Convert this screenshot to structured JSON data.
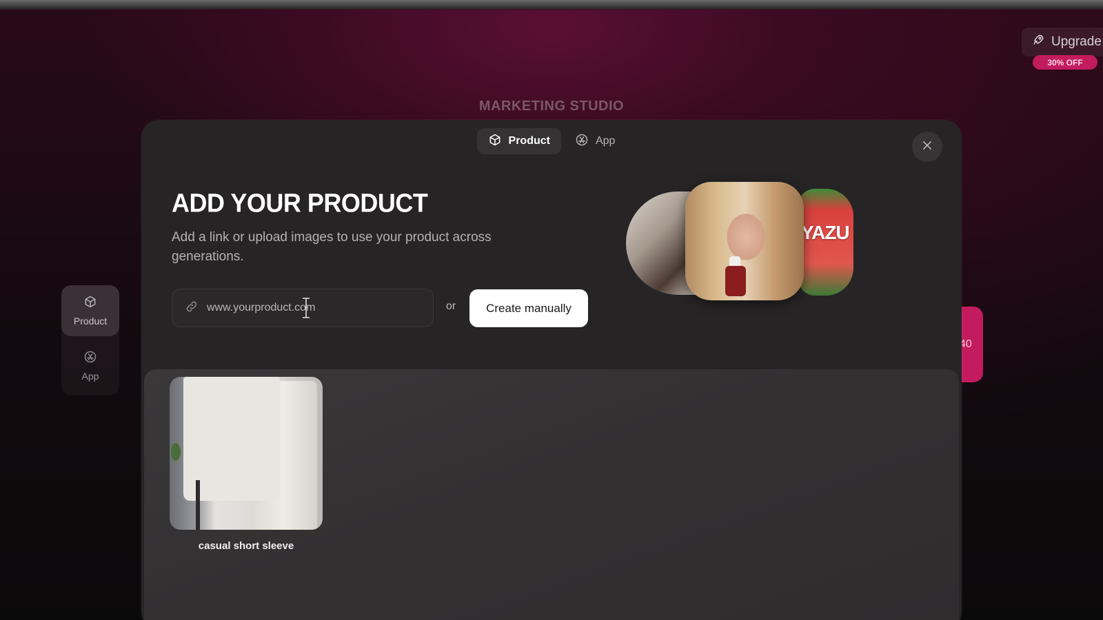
{
  "background": {
    "title": "MARKETING STUDIO",
    "upgrade_label": "Upgrade",
    "discount_badge": "30% OFF",
    "side_nav": [
      {
        "label": "Product",
        "icon": "cube-icon",
        "active": true
      },
      {
        "label": "App",
        "icon": "app-store-icon",
        "active": false
      }
    ],
    "pink_pill_text": "40"
  },
  "modal": {
    "tabs": [
      {
        "label": "Product",
        "icon": "cube-icon",
        "active": true
      },
      {
        "label": "App",
        "icon": "app-store-icon",
        "active": false
      }
    ],
    "heading": "ADD YOUR PRODUCT",
    "subtext": "Add a link or upload images to use your product across generations.",
    "url_input": {
      "value": "",
      "placeholder": "www.yourproduct.com"
    },
    "or_label": "or",
    "create_button_label": "Create manually",
    "collage_brand_text": "YAZU",
    "products": [
      {
        "name": "casual short sleeve"
      }
    ]
  },
  "colors": {
    "accent": "#c21c5e",
    "modal_bg": "#262425",
    "primary_button_bg": "#ffffff"
  }
}
